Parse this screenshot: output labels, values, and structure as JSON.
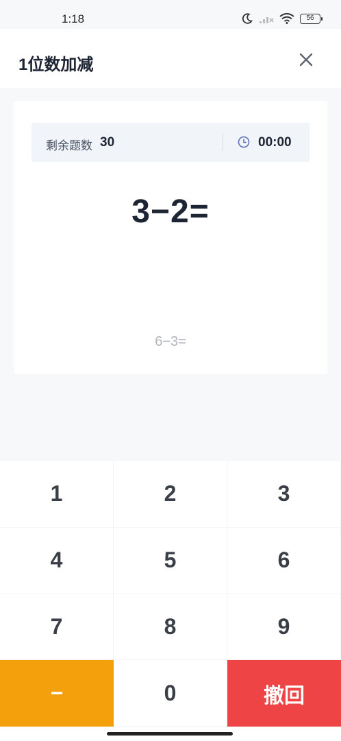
{
  "status_bar": {
    "time": "1:18",
    "battery": "56"
  },
  "header": {
    "title": "1位数加减"
  },
  "info": {
    "remaining_label": "剩余题数",
    "remaining_count": "30",
    "timer": "00:00"
  },
  "question": {
    "current": "3−2=",
    "next": "6−3="
  },
  "keypad": {
    "keys": [
      "1",
      "2",
      "3",
      "4",
      "5",
      "6",
      "7",
      "8",
      "9"
    ],
    "minus": "−",
    "zero": "0",
    "undo": "撤回"
  },
  "colors": {
    "minus_key": "#f4a00d",
    "undo_key": "#ee4446",
    "text_dark": "#1d2433"
  }
}
